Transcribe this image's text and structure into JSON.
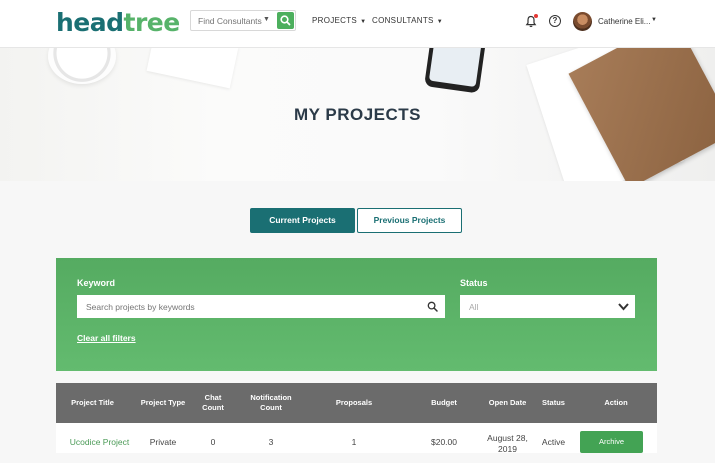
{
  "brand": {
    "logo_part1": "head",
    "logo_part2": "tree"
  },
  "header": {
    "search_placeholder": "Find Consultants",
    "nav": [
      {
        "label": "PROJECTS"
      },
      {
        "label": "CONSULTANTS"
      }
    ],
    "user_name": "Catherine Eli...",
    "icons": [
      "search-icon",
      "bell-icon",
      "help-icon",
      "chevron-down-icon"
    ]
  },
  "hero": {
    "title": "MY PROJECTS"
  },
  "tabs": [
    {
      "label": "Current Projects",
      "active": true
    },
    {
      "label": "Previous Projects",
      "active": false
    }
  ],
  "filters": {
    "keyword_label": "Keyword",
    "keyword_placeholder": "Search projects by keywords",
    "status_label": "Status",
    "status_value": "All",
    "clear_label": "Clear all filters"
  },
  "table": {
    "columns": [
      "Project Title",
      "Project Type",
      "Chat Count",
      "Notification Count",
      "Proposals",
      "Budget",
      "Open Date",
      "Status",
      "Action"
    ],
    "rows": [
      {
        "title": "Ucodice Project",
        "type": "Private",
        "chat_count": "0",
        "notification_count": "3",
        "proposals": "1",
        "budget": "$20.00",
        "open_date": "August 28, 2019",
        "status": "Active",
        "action": "Archive"
      }
    ]
  },
  "colors": {
    "brand_teal": "#1a6f73",
    "brand_green": "#57b36a",
    "filter_green": "#5cb468",
    "table_header": "#6b6b6b",
    "archive_button": "#43a354"
  }
}
